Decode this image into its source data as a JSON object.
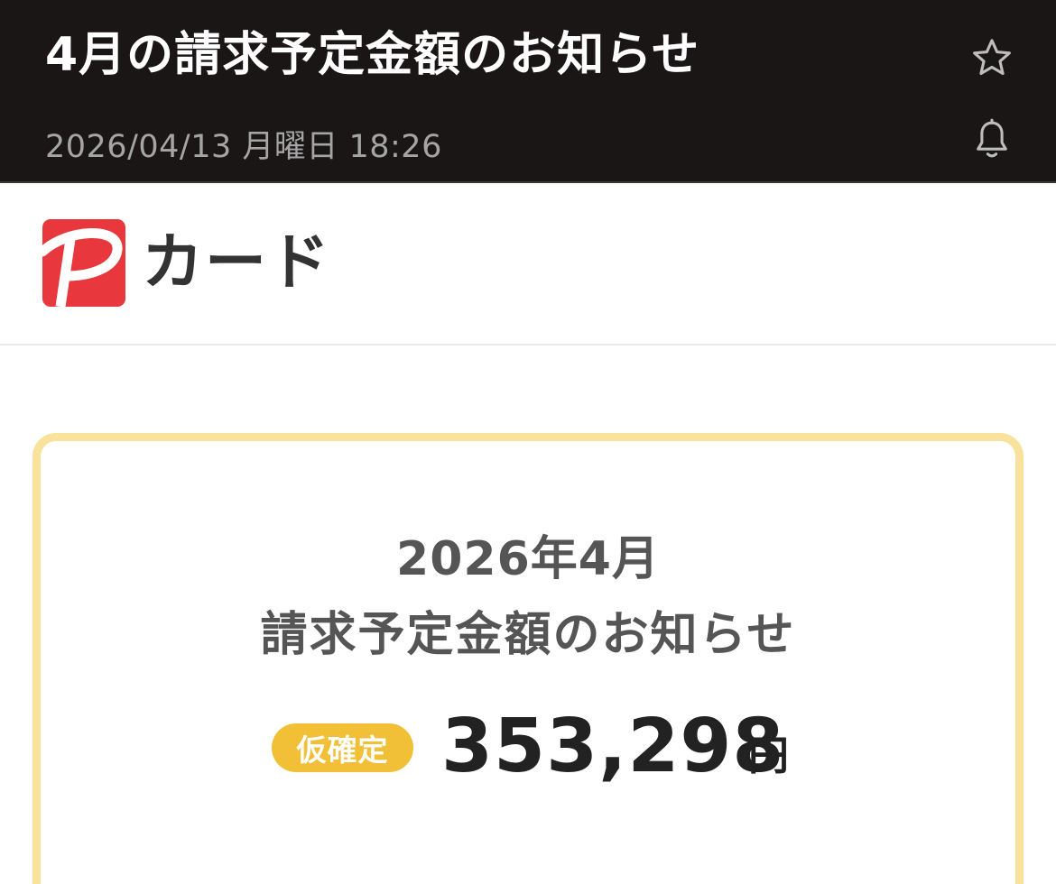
{
  "header": {
    "title": "4月の請求予定金額のお知らせ",
    "date": "2026/04/13 月曜日 18:26",
    "star_icon": "star-outline-icon",
    "bell_icon": "bell-outline-icon"
  },
  "brand": {
    "logo_icon": "paypay-p-logo",
    "name": "カード",
    "logo_color": "#e8383d"
  },
  "card": {
    "month": "2026年4月",
    "subtitle": "請求予定金額のお知らせ",
    "badge": "仮確定",
    "amount": "353,298",
    "currency": "円",
    "border_color": "#f8e29c",
    "badge_color": "#f2c036"
  },
  "colors": {
    "header_bg": "#1a1616",
    "header_text": "#ffffff",
    "date_text": "#a5a5a5"
  }
}
